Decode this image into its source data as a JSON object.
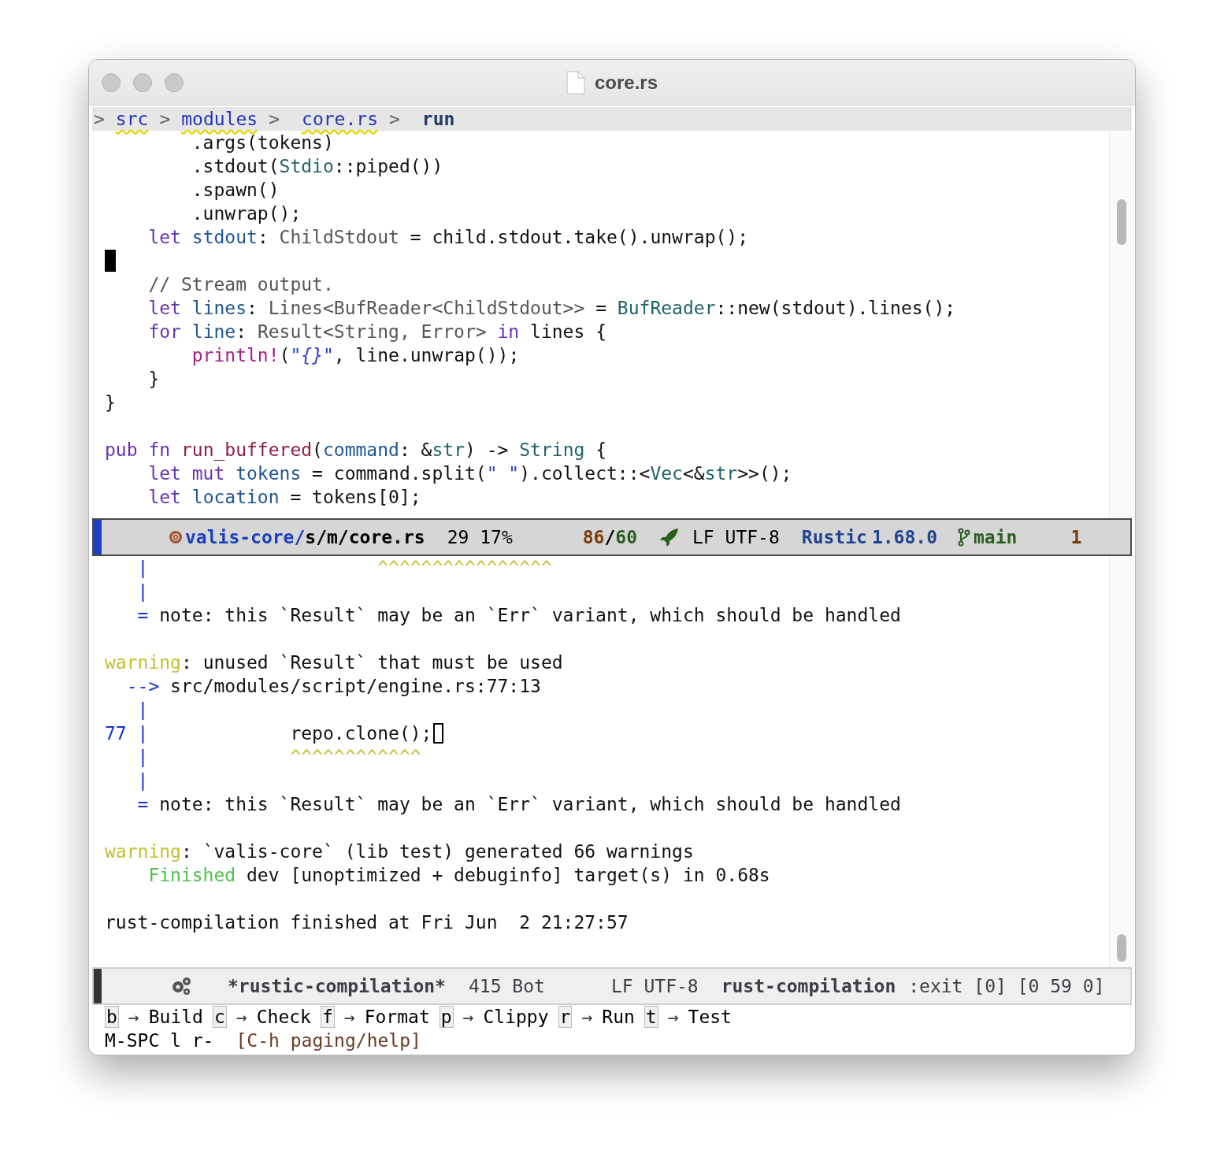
{
  "window": {
    "title": "core.rs"
  },
  "breadcrumb": [
    {
      "kind": "separator",
      "text": ">"
    },
    {
      "kind": "directory",
      "text": "src"
    },
    {
      "kind": "separator",
      "text": ">"
    },
    {
      "kind": "directory",
      "text": "modules"
    },
    {
      "kind": "separator",
      "text": ">"
    },
    {
      "kind": "file",
      "text": "core.rs"
    },
    {
      "kind": "separator",
      "text": ">"
    },
    {
      "kind": "symbol",
      "text": "run"
    }
  ],
  "editor": {
    "lines": [
      {
        "cursor": false,
        "tokens": [
          {
            "kind": "plain",
            "text": "        .args(tokens)"
          }
        ]
      },
      {
        "cursor": false,
        "tokens": [
          {
            "kind": "plain",
            "text": "        .stdout("
          },
          {
            "kind": "type",
            "text": "Stdio"
          },
          {
            "kind": "plain",
            "text": "::piped())"
          }
        ]
      },
      {
        "cursor": false,
        "tokens": [
          {
            "kind": "plain",
            "text": "        .spawn()"
          }
        ]
      },
      {
        "cursor": false,
        "tokens": [
          {
            "kind": "plain",
            "text": "        .unwrap();"
          }
        ]
      },
      {
        "cursor": false,
        "tokens": [
          {
            "kind": "keyword",
            "text": "    let "
          },
          {
            "kind": "variable",
            "text": "stdout"
          },
          {
            "kind": "plain",
            "text": ": "
          },
          {
            "kind": "annotation",
            "text": "ChildStdout"
          },
          {
            "kind": "plain",
            "text": " = child.stdout.take().unwrap();"
          }
        ]
      },
      {
        "cursor": true
      },
      {
        "cursor": false,
        "tokens": [
          {
            "kind": "comment",
            "text": "    // Stream output."
          }
        ]
      },
      {
        "cursor": false,
        "tokens": [
          {
            "kind": "keyword",
            "text": "    let "
          },
          {
            "kind": "variable",
            "text": "lines"
          },
          {
            "kind": "plain",
            "text": ": "
          },
          {
            "kind": "annotation",
            "text": "Lines<BufReader<ChildStdout>>"
          },
          {
            "kind": "plain",
            "text": " = "
          },
          {
            "kind": "type",
            "text": "BufReader"
          },
          {
            "kind": "plain",
            "text": "::new(stdout).lines();"
          }
        ]
      },
      {
        "cursor": false,
        "tokens": [
          {
            "kind": "keyword",
            "text": "    for "
          },
          {
            "kind": "variable",
            "text": "line"
          },
          {
            "kind": "plain",
            "text": ": "
          },
          {
            "kind": "annotation",
            "text": "Result<String, Error> "
          },
          {
            "kind": "keyword",
            "text": "in"
          },
          {
            "kind": "plain",
            "text": " lines {"
          }
        ]
      },
      {
        "cursor": false,
        "tokens": [
          {
            "kind": "macro",
            "text": "        println!"
          },
          {
            "kind": "plain",
            "text": "("
          },
          {
            "kind": "string",
            "text": "\""
          },
          {
            "kind": "format",
            "text": "{}"
          },
          {
            "kind": "string",
            "text": "\""
          },
          {
            "kind": "plain",
            "text": ", line.unwrap());"
          }
        ]
      },
      {
        "cursor": false,
        "tokens": [
          {
            "kind": "plain",
            "text": "    }"
          }
        ]
      },
      {
        "cursor": false,
        "tokens": [
          {
            "kind": "plain",
            "text": "}"
          }
        ]
      },
      {
        "cursor": false
      },
      {
        "cursor": false,
        "tokens": [
          {
            "kind": "keyword",
            "text": "pub fn "
          },
          {
            "kind": "function",
            "text": "run_buffered"
          },
          {
            "kind": "plain",
            "text": "("
          },
          {
            "kind": "variable",
            "text": "command"
          },
          {
            "kind": "plain",
            "text": ": &"
          },
          {
            "kind": "type",
            "text": "str"
          },
          {
            "kind": "plain",
            "text": ") -> "
          },
          {
            "kind": "type",
            "text": "String"
          },
          {
            "kind": "plain",
            "text": " {"
          }
        ]
      },
      {
        "cursor": false,
        "tokens": [
          {
            "kind": "keyword",
            "text": "    let mut "
          },
          {
            "kind": "variable",
            "text": "tokens"
          },
          {
            "kind": "plain",
            "text": " = command.split("
          },
          {
            "kind": "string",
            "text": "\" \""
          },
          {
            "kind": "plain",
            "text": ").collect::<"
          },
          {
            "kind": "type",
            "text": "Vec"
          },
          {
            "kind": "plain",
            "text": "<&"
          },
          {
            "kind": "type",
            "text": "str"
          },
          {
            "kind": "plain",
            "text": ">>();"
          }
        ]
      },
      {
        "cursor": false,
        "tokens": [
          {
            "kind": "keyword",
            "text": "    let "
          },
          {
            "kind": "variable",
            "text": "location"
          },
          {
            "kind": "plain",
            "text": " = tokens[0];"
          }
        ]
      }
    ]
  },
  "editor_mode_line": {
    "active": true,
    "buffer_directory": "valis-core/",
    "buffer_name": "s/m/core.rs",
    "position": "29 17%",
    "stat_1": "86",
    "stat_separator": "/",
    "stat_2": "60",
    "encoding": "LF UTF-8",
    "major_mode": "Rustic",
    "version": "1.68.0",
    "branch": "main",
    "count": "1"
  },
  "compilation": {
    "lines": [
      {
        "cursor": false,
        "tokens": [
          {
            "kind": "gutter",
            "text": "   |"
          },
          {
            "kind": "caret",
            "text": "                     ^^^^^^^^^^^^^^^^"
          }
        ]
      },
      {
        "cursor": false,
        "tokens": [
          {
            "kind": "gutter",
            "text": "   |"
          }
        ]
      },
      {
        "cursor": false,
        "tokens": [
          {
            "kind": "gutter",
            "text": "   ="
          },
          {
            "kind": "plain",
            "text": " note: this `Result` may be an `Err` variant, which should be handled"
          }
        ]
      },
      {
        "cursor": false
      },
      {
        "cursor": false,
        "tokens": [
          {
            "kind": "warning",
            "text": "warning"
          },
          {
            "kind": "plain",
            "text": ": unused `Result` that must be used"
          }
        ]
      },
      {
        "cursor": false,
        "tokens": [
          {
            "kind": "gutter",
            "text": "  -->"
          },
          {
            "kind": "plain",
            "text": " src/modules/script/engine.rs:77:13"
          }
        ]
      },
      {
        "cursor": false,
        "tokens": [
          {
            "kind": "gutter",
            "text": "   |"
          }
        ]
      },
      {
        "cursor": true,
        "tokens": [
          {
            "kind": "gutter",
            "text": "77 |"
          },
          {
            "kind": "plain",
            "text": "             repo.clone();"
          }
        ]
      },
      {
        "cursor": false,
        "tokens": [
          {
            "kind": "gutter",
            "text": "   |"
          },
          {
            "kind": "caret",
            "text": "             ^^^^^^^^^^^^"
          }
        ]
      },
      {
        "cursor": false,
        "tokens": [
          {
            "kind": "gutter",
            "text": "   |"
          }
        ]
      },
      {
        "cursor": false,
        "tokens": [
          {
            "kind": "gutter",
            "text": "   ="
          },
          {
            "kind": "plain",
            "text": " note: this `Result` may be an `Err` variant, which should be handled"
          }
        ]
      },
      {
        "cursor": false
      },
      {
        "cursor": false,
        "tokens": [
          {
            "kind": "warning",
            "text": "warning"
          },
          {
            "kind": "plain",
            "text": ": `valis-core` (lib test) generated 66 warnings"
          }
        ]
      },
      {
        "cursor": false,
        "tokens": [
          {
            "kind": "finished",
            "text": "    Finished"
          },
          {
            "kind": "plain",
            "text": " dev [unoptimized + debuginfo] target(s) in 0.68s"
          }
        ]
      },
      {
        "cursor": false
      },
      {
        "cursor": false,
        "tokens": [
          {
            "kind": "plain",
            "text": "rust-compilation finished at Fri Jun  2 21:27:57"
          }
        ]
      }
    ]
  },
  "compilation_mode_line": {
    "active": false,
    "buffer_name": "*rustic-compilation*",
    "position": "415 Bot",
    "encoding": "LF UTF-8",
    "major_mode": "rust-compilation",
    "process": ":exit [0] [0 59 0]"
  },
  "key_hints": [
    {
      "key": "b",
      "arrow": "→",
      "label": "Build"
    },
    {
      "key": "c",
      "arrow": "→",
      "label": "Check"
    },
    {
      "key": "f",
      "arrow": "→",
      "label": "Format"
    },
    {
      "key": "p",
      "arrow": "→",
      "label": "Clippy"
    },
    {
      "key": "r",
      "arrow": "→",
      "label": "Run"
    },
    {
      "key": "t",
      "arrow": "→",
      "label": "Test"
    }
  ],
  "echo_area": {
    "prompt": "M-SPC l r-",
    "hint": "[C-h paging/help]"
  }
}
